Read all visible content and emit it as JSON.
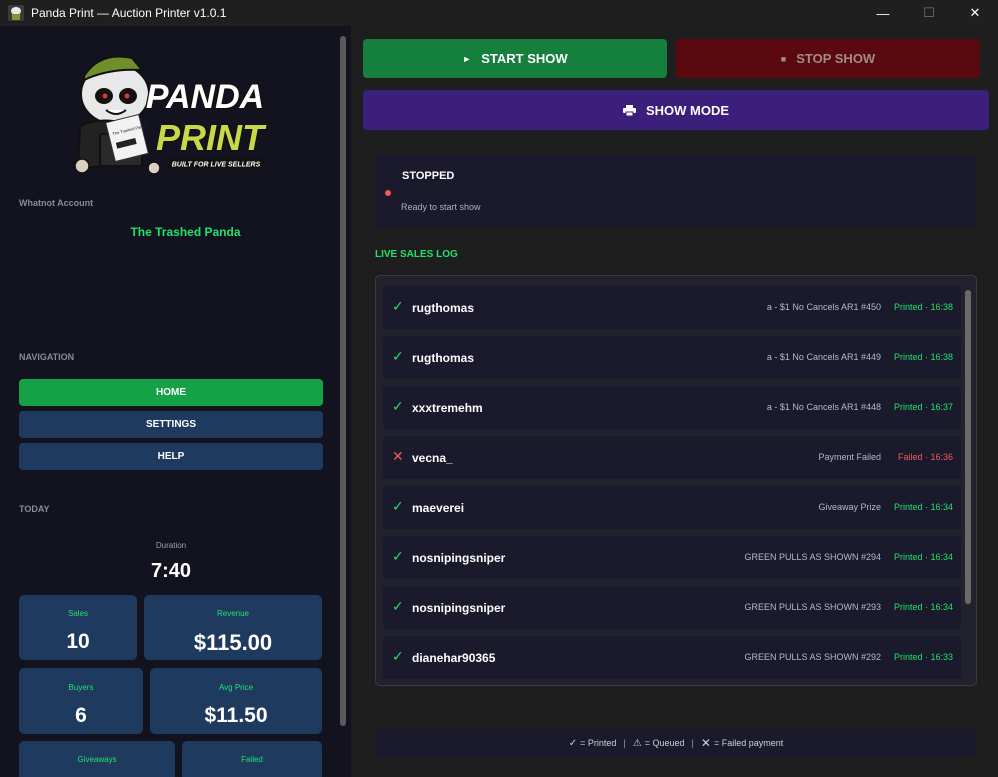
{
  "window": {
    "title": "Panda Print — Auction Printer  v1.0.1",
    "minimize": "—",
    "maximize": "☐",
    "close": "✕"
  },
  "sidebar": {
    "logo": {
      "line1": "PANDA",
      "line2": "PRINT",
      "tagline": "BUILT FOR LIVE SELLERS",
      "label_text": "The Trashed Panda"
    },
    "account_label": "Whatnot Account",
    "account_name": "The Trashed Panda",
    "nav_label": "NAVIGATION",
    "nav": [
      "HOME",
      "SETTINGS",
      "HELP"
    ],
    "today_label": "TODAY",
    "duration_label": "Duration",
    "duration_value": "7:40",
    "stats": {
      "sales_label": "Sales",
      "sales_value": "10",
      "revenue_label": "Revenue",
      "revenue_value": "$115.00",
      "buyers_label": "Buyers",
      "buyers_value": "6",
      "avg_label": "Avg Price",
      "avg_value": "$11.50",
      "giveaways_label": "Giveaways",
      "failed_label": "Failed"
    }
  },
  "controls": {
    "start_label": "START SHOW",
    "start_icon": "play-icon",
    "stop_label": "STOP SHOW",
    "stop_icon": "stop-icon",
    "show_mode_label": "SHOW MODE",
    "show_mode_icon": "printer-icon"
  },
  "status": {
    "title": "STOPPED",
    "subtitle": "Ready to start show",
    "dot_color": "#f05a5a"
  },
  "log": {
    "label": "LIVE SALES LOG",
    "rows": [
      {
        "mark": "✓",
        "ok": true,
        "user": "rugthomas",
        "item": "a - $1 No Cancels AR1 #450",
        "status": "Printed · 16:38"
      },
      {
        "mark": "✓",
        "ok": true,
        "user": "rugthomas",
        "item": "a - $1 No Cancels AR1 #449",
        "status": "Printed · 16:38"
      },
      {
        "mark": "✓",
        "ok": true,
        "user": "xxxtremehm",
        "item": "a - $1 No Cancels AR1 #448",
        "status": "Printed · 16:37"
      },
      {
        "mark": "✕",
        "ok": false,
        "user": "vecna_",
        "item": "Payment Failed",
        "status": "Failed · 16:36"
      },
      {
        "mark": "✓",
        "ok": true,
        "user": "maeverei",
        "item": "Giveaway Prize",
        "status": "Printed · 16:34"
      },
      {
        "mark": "✓",
        "ok": true,
        "user": "nosnipingsniper",
        "item": "GREEN PULLS AS SHOWN #294",
        "status": "Printed · 16:34"
      },
      {
        "mark": "✓",
        "ok": true,
        "user": "nosnipingsniper",
        "item": "GREEN PULLS AS SHOWN #293",
        "status": "Printed · 16:34"
      },
      {
        "mark": "✓",
        "ok": true,
        "user": "dianehar90365",
        "item": "GREEN PULLS AS SHOWN #292",
        "status": "Printed · 16:33"
      }
    ]
  },
  "legend": {
    "printed_glyph": "✓",
    "printed": "= Printed",
    "queued_glyph": "⚠",
    "queued": "= Queued",
    "failed_glyph": "✕",
    "failed": "= Failed payment",
    "sep": "|"
  },
  "colors": {
    "accent_green": "#22e06b",
    "start_green": "#15803d",
    "stop_red": "#5a0a0e",
    "show_purple": "#3b1f7a",
    "nav_blue": "#1f3a5f",
    "fail_red": "#f05a5a"
  }
}
